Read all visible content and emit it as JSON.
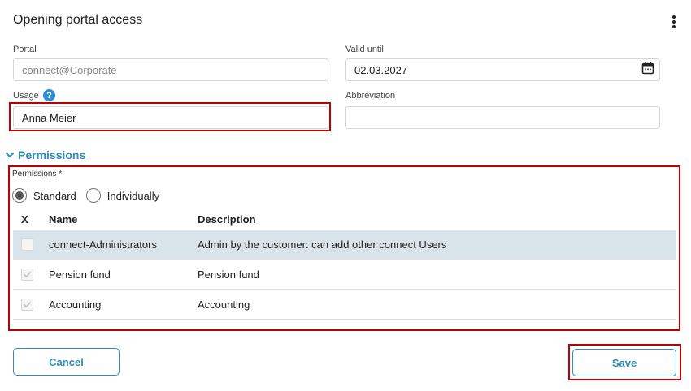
{
  "header": {
    "title": "Opening portal access",
    "menu_icon": "kebab-menu-icon"
  },
  "form": {
    "portal": {
      "label": "Portal",
      "value": "connect@Corporate"
    },
    "valid_until": {
      "label": "Valid until",
      "value": "02.03.2027",
      "icon": "calendar-icon"
    },
    "usage": {
      "label": "Usage",
      "value": "Anna Meier",
      "help_icon": "?"
    },
    "abbreviation": {
      "label": "Abbreviation",
      "value": ""
    }
  },
  "permissions": {
    "section_title": "Permissions",
    "field_label": "Permissions *",
    "mode": {
      "selected": "Standard",
      "options": [
        "Standard",
        "Individually"
      ]
    },
    "columns": [
      "X",
      "Name",
      "Description"
    ],
    "rows": [
      {
        "name": "connect-Administrators",
        "description": "Admin by the customer: can add other connect Users",
        "checked": false,
        "selected": true
      },
      {
        "name": "Pension fund",
        "description": "Pension fund",
        "checked": true,
        "selected": false
      },
      {
        "name": "Accounting",
        "description": "Accounting",
        "checked": true,
        "selected": false
      }
    ]
  },
  "actions": {
    "cancel_label": "Cancel",
    "save_label": "Save"
  },
  "colors": {
    "accent": "#2d8fb8",
    "highlight": "#c00000",
    "selected_row": "#d9e4ea",
    "help_icon": "#2d8fd5"
  }
}
